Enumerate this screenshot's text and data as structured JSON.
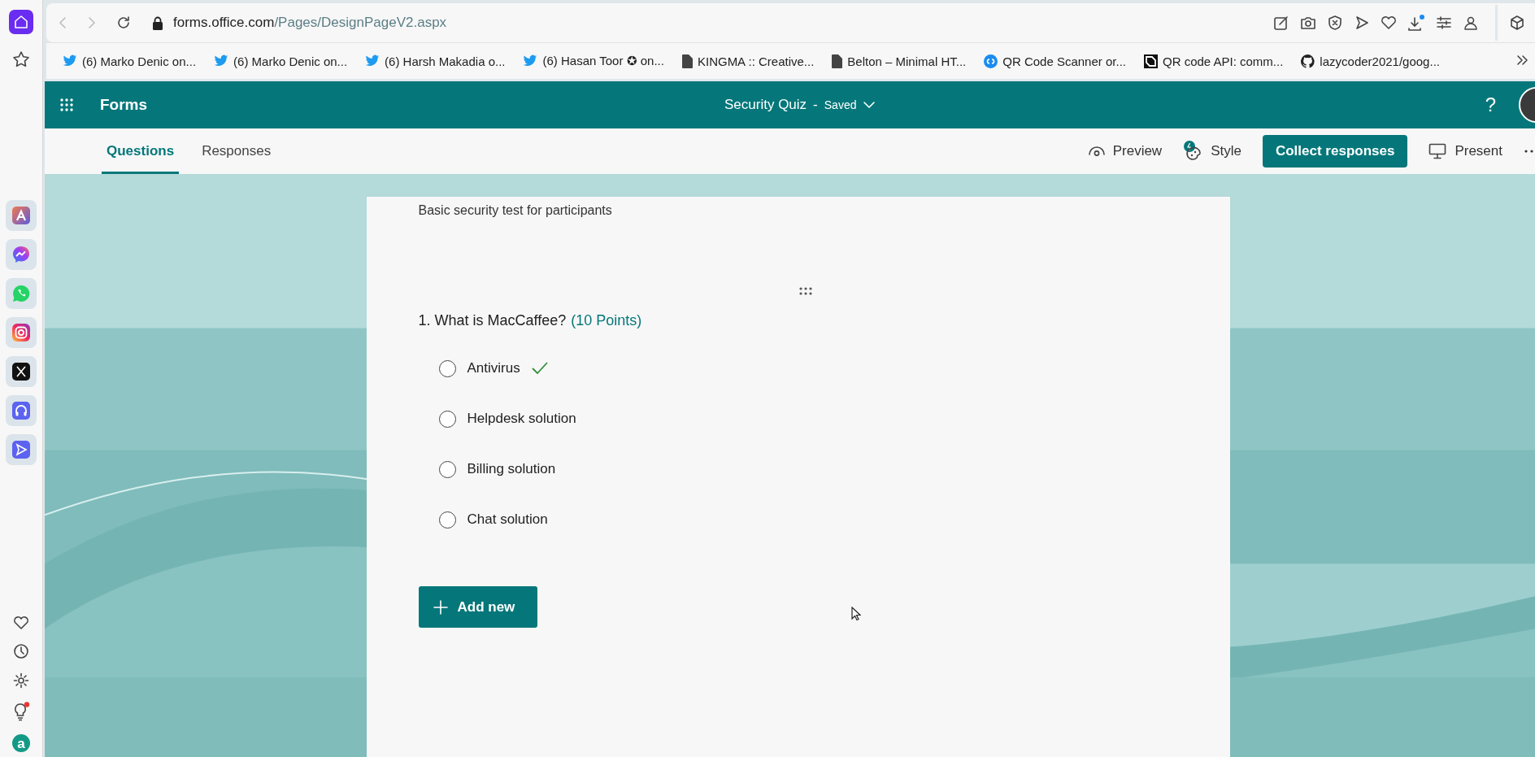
{
  "sidebar": {
    "account_letter": "a"
  },
  "address_bar": {
    "host": "forms.office.com",
    "path": "/Pages/DesignPageV2.aspx"
  },
  "bookmarks": [
    {
      "label": "(6) Marko Denic on...",
      "kind": "twitter"
    },
    {
      "label": "(6) Marko Denic on...",
      "kind": "twitter"
    },
    {
      "label": "(6) Harsh Makadia o...",
      "kind": "twitter"
    },
    {
      "label": "(6) Hasan Toor ✪ on...",
      "kind": "twitter"
    },
    {
      "label": "KINGMA :: Creative...",
      "kind": "page"
    },
    {
      "label": "Belton – Minimal HT...",
      "kind": "page"
    },
    {
      "label": "QR Code Scanner or...",
      "kind": "qr-scanner"
    },
    {
      "label": "QR code API: comm...",
      "kind": "qr-api"
    },
    {
      "label": "lazycoder2021/goog...",
      "kind": "github"
    }
  ],
  "app_header": {
    "app_name": "Forms",
    "form_title": "Security Quiz",
    "separator": "-",
    "save_status": "Saved",
    "help": "?"
  },
  "tabs": [
    {
      "label": "Questions",
      "selected": true
    },
    {
      "label": "Responses",
      "selected": false
    }
  ],
  "actions": [
    {
      "label": "Preview",
      "kind": "preview"
    },
    {
      "label": "Style",
      "kind": "style"
    },
    {
      "label": "Collect responses",
      "kind": "primary"
    },
    {
      "label": "Present",
      "kind": "present"
    }
  ],
  "form": {
    "description": "Basic security test for participants",
    "question": {
      "text": "1. What is MacCaffee?",
      "points": "(10 Points)"
    },
    "options": [
      {
        "label": "Antivirus",
        "correct": true,
        "selected": false
      },
      {
        "label": "Helpdesk solution",
        "correct": false,
        "selected": false
      },
      {
        "label": "Billing solution",
        "correct": false,
        "selected": false
      },
      {
        "label": "Chat solution",
        "correct": false,
        "selected": false
      }
    ],
    "add_button": "Add new"
  }
}
